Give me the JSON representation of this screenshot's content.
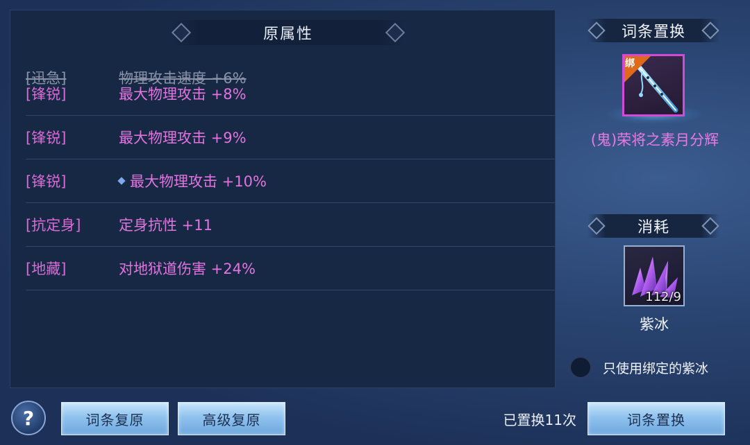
{
  "left_panel": {
    "title": "原属性",
    "struck_row": {
      "tag": "[迅急]",
      "value": "物理攻击速度 +6%"
    },
    "rows": [
      {
        "tag": "[锋锐]",
        "value": "最大物理攻击 +8%"
      },
      {
        "tag": "[锋锐]",
        "value": "最大物理攻击 +9%"
      },
      {
        "tag": "[锋锐]",
        "value": "最大物理攻击 +10%"
      },
      {
        "tag": "[抗定身]",
        "value": "定身抗性 +11"
      },
      {
        "tag": "[地藏]",
        "value": "对地狱道伤害 +24%"
      }
    ]
  },
  "right_panel": {
    "replace_title": "词条置换",
    "bind_badge": "绑",
    "weapon_name": "(鬼)荣将之素月分辉",
    "cost_title": "消耗",
    "crystal_count": "112/9",
    "crystal_name": "紫冰",
    "bind_only_label": "只使用绑定的紫冰"
  },
  "bottom_bar": {
    "help_label": "?",
    "restore_label": "词条复原",
    "advanced_restore_label": "高级复原",
    "replaced_count_text": "已置换11次",
    "replace_button_label": "词条置换"
  },
  "colors": {
    "attribute_pink": "#e274de",
    "struck_gray": "#8a92a8",
    "weapon_border": "#d24bd8",
    "bind_badge": "#e06a1c",
    "button_blue": "#8fc2ee"
  },
  "icons": {
    "weapon": "flute-weapon-icon",
    "crystal": "purple-crystal-icon",
    "help": "question-icon"
  }
}
